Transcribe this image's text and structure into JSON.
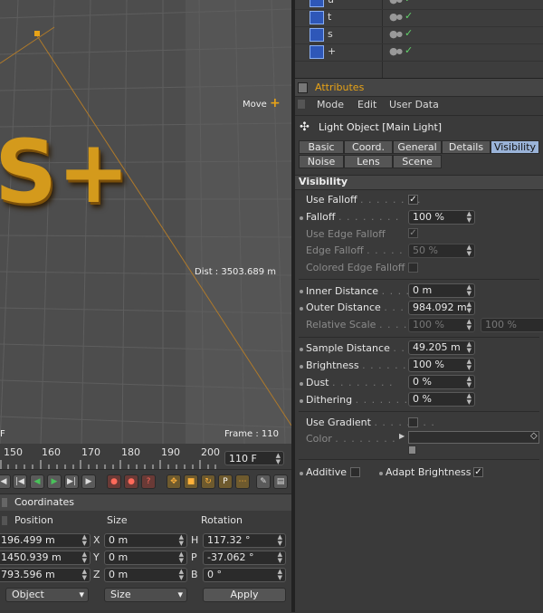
{
  "viewport": {
    "mode_label": "Move",
    "dist_label": "Dist : 3503.689 m",
    "frame_label": "Frame : 110",
    "corner_letter": "F",
    "text_object": "S+"
  },
  "timeline": {
    "ticks": [
      "150",
      "160",
      "170",
      "180",
      "190",
      "200"
    ],
    "current_frame": "110 F"
  },
  "coordinates": {
    "title": "Coordinates",
    "headers": {
      "position": "Position",
      "size": "Size",
      "rotation": "Rotation"
    },
    "rows": [
      {
        "pos": "196.499 m",
        "axis": "X",
        "size": "0 m",
        "rot_axis": "H",
        "rot": "117.32 °"
      },
      {
        "pos": "1450.939 m",
        "axis": "Y",
        "size": "0 m",
        "rot_axis": "P",
        "rot": "-37.062 °"
      },
      {
        "pos": "793.596 m",
        "axis": "Z",
        "size": "0 m",
        "rot_axis": "B",
        "rot": "0 °"
      }
    ],
    "mode_select": "Object",
    "size_select": "Size",
    "apply_label": "Apply"
  },
  "object_list": [
    {
      "name": "u"
    },
    {
      "name": "t"
    },
    {
      "name": "s"
    },
    {
      "name": "+"
    }
  ],
  "attributes": {
    "title": "Attributes",
    "menu": [
      "Mode",
      "Edit",
      "User Data"
    ],
    "object_title": "Light Object [Main Light]",
    "tabs_row1": [
      "Basic",
      "Coord.",
      "General",
      "Details",
      "Visibility"
    ],
    "tabs_row2": [
      "Noise",
      "Lens",
      "Scene"
    ],
    "active_tab": "Visibility",
    "section": "Visibility",
    "use_falloff": "Use Falloff",
    "falloff": "Falloff",
    "falloff_value": "100 %",
    "use_edge_falloff": "Use Edge Falloff",
    "edge_falloff": "Edge Falloff",
    "edge_falloff_value": "50 %",
    "colored_edge_falloff": "Colored Edge Falloff",
    "inner_distance": "Inner Distance",
    "inner_distance_value": "0 m",
    "outer_distance": "Outer Distance",
    "outer_distance_value": "984.092 m",
    "relative_scale": "Relative Scale",
    "relative_scale_value1": "100 %",
    "relative_scale_value2": "100 %",
    "sample_distance": "Sample Distance",
    "sample_distance_value": "49.205 m",
    "brightness": "Brightness",
    "brightness_value": "100 %",
    "dust": "Dust",
    "dust_value": "0 %",
    "dithering": "Dithering",
    "dithering_value": "0 %",
    "use_gradient": "Use Gradient",
    "color": "Color",
    "additive": "Additive",
    "adapt_brightness": "Adapt Brightness",
    "dots": ". . . . . . . ."
  },
  "colors": {
    "accent_orange": "#e8a317",
    "active_tab": "#9ab3d8",
    "check_green": "#62d36b"
  }
}
